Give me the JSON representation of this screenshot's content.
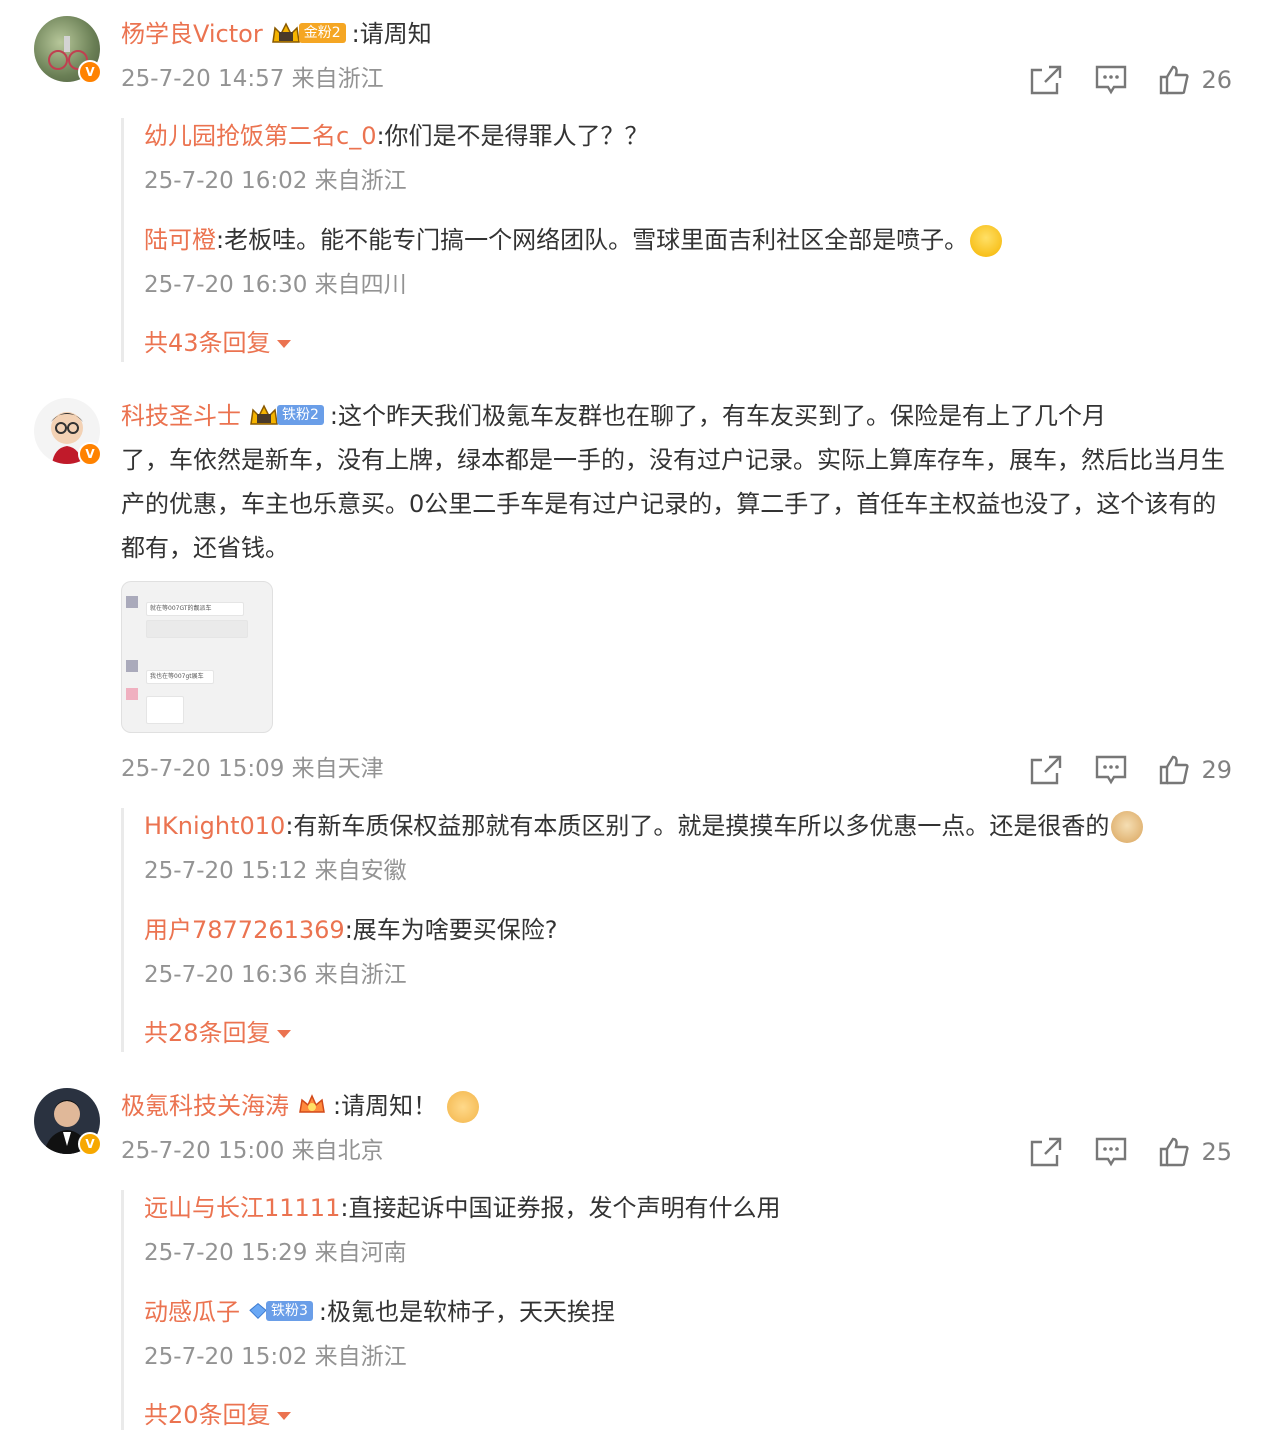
{
  "comments": [
    {
      "user": "杨学良Victor",
      "badge": "金粉2",
      "text": ":请周知",
      "meta": "25-7-20 14:57 来自浙江",
      "likes": "26",
      "replies": [
        {
          "user": "幼儿园抢饭第二名c_0",
          "text": ":你们是不是得罪人了？？",
          "meta": "25-7-20 16:02 来自浙江"
        },
        {
          "user": "陆可橙",
          "text": ":老板哇。能不能专门搞一个网络团队。雪球里面吉利社区全部是喷子。",
          "meta": "25-7-20 16:30 来自四川"
        }
      ],
      "more": "共43条回复"
    },
    {
      "user": "科技圣斗士",
      "badge": "铁粉2",
      "text_first": ":这个昨天我们极氪车友群也在聊了，有车友买到了。保险是有上了几个月",
      "text_rest": "了，车依然是新车，没有上牌，绿本都是一手的，没有过户记录。实际上算库存车，展车，然后比当月生产的优惠，车主也乐意买。0公里二手车是有过户记录的，算二手了，首任车主权益也没了，这个该有的都有，还省钱。",
      "image": {
        "line1": "就在等007GT的靓派车",
        "line2": "我也在等007gt展车"
      },
      "meta": "25-7-20 15:09 来自天津",
      "likes": "29",
      "replies": [
        {
          "user": "HKnight010",
          "text": ":有新车质保权益那就有本质区别了。就是摸摸车所以多优惠一点。还是很香的",
          "meta": "25-7-20 15:12 来自安徽"
        },
        {
          "user": "用户7877261369",
          "text": ":展车为啥要买保险?",
          "meta": "25-7-20 16:36 来自浙江"
        }
      ],
      "more": "共28条回复"
    },
    {
      "user": "极氪科技关海涛",
      "text": ":请周知！",
      "meta": "25-7-20 15:00 来自北京",
      "likes": "25",
      "replies": [
        {
          "user": "远山与长江11111",
          "text": ":直接起诉中国证券报，发个声明有什么用",
          "meta": "25-7-20 15:29 来自河南"
        },
        {
          "user": "动感瓜子",
          "badge": "铁粉3",
          "text": ":极氪也是软柿子，天天挨捏",
          "meta": "25-7-20 15:02 来自浙江"
        }
      ],
      "more": "共20条回复"
    }
  ],
  "colors": {
    "username": "#eb7350",
    "meta": "#939393",
    "gold": "#f5a623",
    "iron": "#6a9ee8"
  },
  "icons": [
    "share-icon",
    "comment-icon",
    "like-icon",
    "caret-down-icon",
    "verified-v-icon",
    "crown-icon"
  ]
}
